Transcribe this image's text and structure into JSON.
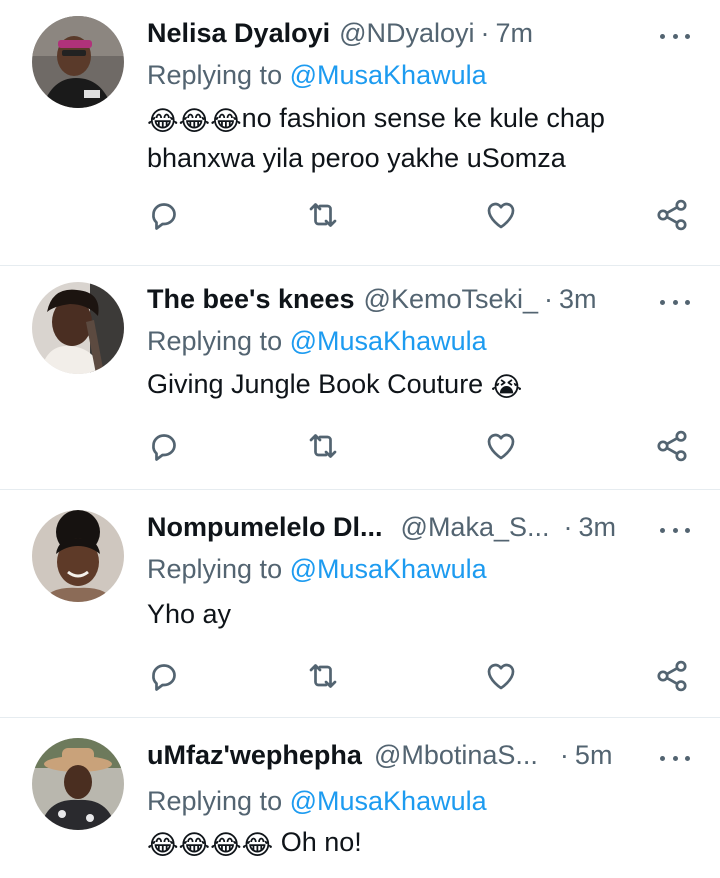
{
  "tweets": [
    {
      "name": "Nelisa Dyaloyi",
      "handle": "@NDyaloyi",
      "separator": "·",
      "time": "7m",
      "replying_label": "Replying to",
      "replying_to": "@MusaKhawula",
      "emoji": "😂😂😂",
      "text": "no fashion sense ke kule chap bhanxwa yila peroo yakhe uSomza"
    },
    {
      "name": "The bee's knees",
      "handle": "@KemoTseki_",
      "separator": "·",
      "time": "3m",
      "replying_label": "Replying to",
      "replying_to": "@MusaKhawula",
      "text": "Giving Jungle Book Couture",
      "emoji": "😭"
    },
    {
      "name": "Nompumelelo Dl...",
      "handle": "@Maka_S...",
      "separator": "·",
      "time": "3m",
      "replying_label": "Replying to",
      "replying_to": "@MusaKhawula",
      "text": "Yho ay"
    },
    {
      "name": "uMfaz'wephepha",
      "handle": "@MbotinaS...",
      "separator": "·",
      "time": "5m",
      "replying_label": "Replying to",
      "replying_to": "@MusaKhawula",
      "emoji": "😂😂😂😂",
      "text": " Oh no!"
    }
  ],
  "icons": {
    "reply": "reply-icon",
    "retweet": "retweet-icon",
    "like": "like-icon",
    "share": "share-icon",
    "more": "more-icon"
  },
  "colors": {
    "mention": "#1d9bf0",
    "secondary_text": "#536471",
    "divider": "#e6ecf0"
  }
}
